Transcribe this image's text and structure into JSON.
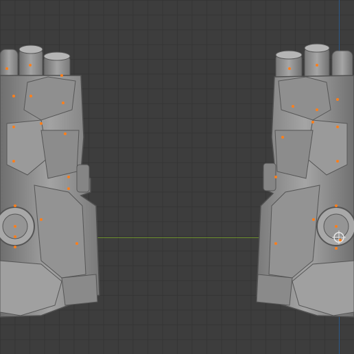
{
  "viewport": {
    "background_color": "#3d3d3d",
    "grid_color": "#353535",
    "x_axis_color": "#6a8d2a",
    "y_axis_color": "#2e5a8c",
    "selection_color": "#ff7f1a",
    "mesh_color": "#8a8a8a"
  },
  "objects": [
    {
      "name": "gauntlet-left"
    },
    {
      "name": "gauntlet-right"
    }
  ]
}
